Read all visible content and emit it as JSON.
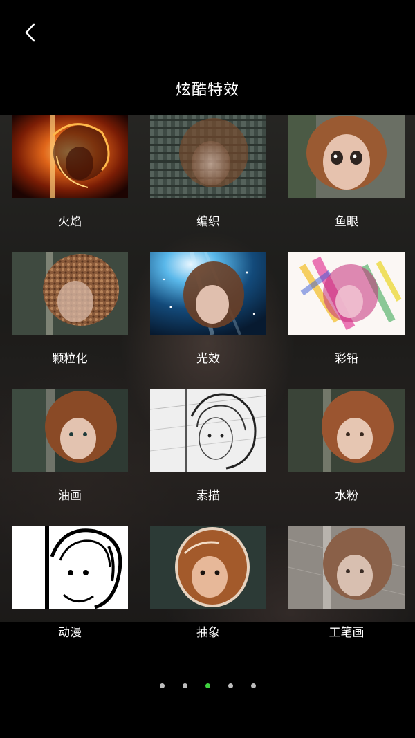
{
  "header": {
    "title": "炫酷特效"
  },
  "effects": [
    {
      "label": "火焰",
      "style": "fire"
    },
    {
      "label": "编织",
      "style": "weave"
    },
    {
      "label": "鱼眼",
      "style": "fisheye"
    },
    {
      "label": "颗粒化",
      "style": "grain"
    },
    {
      "label": "光效",
      "style": "light"
    },
    {
      "label": "彩铅",
      "style": "colorpencil"
    },
    {
      "label": "油画",
      "style": "oil"
    },
    {
      "label": "素描",
      "style": "sketch"
    },
    {
      "label": "水粉",
      "style": "gouache"
    },
    {
      "label": "动漫",
      "style": "anime"
    },
    {
      "label": "抽象",
      "style": "abstract"
    },
    {
      "label": "工笔画",
      "style": "gongbi"
    }
  ],
  "pagination": {
    "count": 5,
    "active_index": 2,
    "active_color": "#3fd13f",
    "inactive_color": "#bdbdbd"
  }
}
